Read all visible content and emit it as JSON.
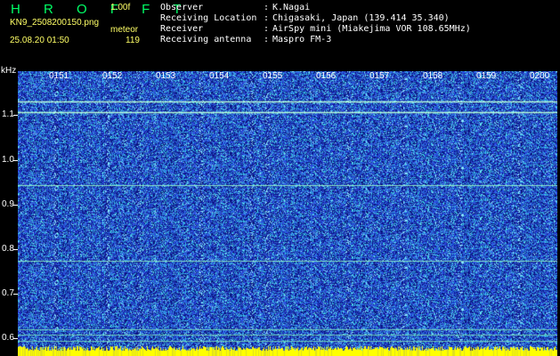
{
  "header": {
    "brand": "H R O F F T",
    "version": "1.00f",
    "filename": "KN9_2508200150.png",
    "mode": "meteor",
    "datetime": "25.08.20 01:50",
    "count": "119"
  },
  "station": [
    {
      "label": "Observer",
      "value": "K.Nagai"
    },
    {
      "label": "Receiving Location",
      "value": "Chigasaki, Japan (139.414 35.340)"
    },
    {
      "label": "Receiver",
      "value": "AirSpy mini (Miakejima VOR 108.65MHz)"
    },
    {
      "label": "Receiving antenna",
      "value": "Maspro FM-3"
    }
  ],
  "axis": {
    "y_unit": "kHz",
    "y_ticks": [
      "1.1",
      "1.0",
      "0.9",
      "0.8",
      "0.7",
      "0.6"
    ],
    "x_ticks": [
      "0151",
      "0152",
      "0153",
      "0154",
      "0155",
      "0156",
      "0157",
      "0158",
      "0159",
      "0200"
    ]
  },
  "colors": {
    "text": "#ffffff",
    "brand": "#00ff66",
    "label_yellow": "#ffff66",
    "background": "#000000",
    "spectrum_base": "#1d38b8",
    "spectrum_noise": "#7ae0ff",
    "carrier_line": "#a8ffd0",
    "bottom_band": "#ffff00"
  }
}
